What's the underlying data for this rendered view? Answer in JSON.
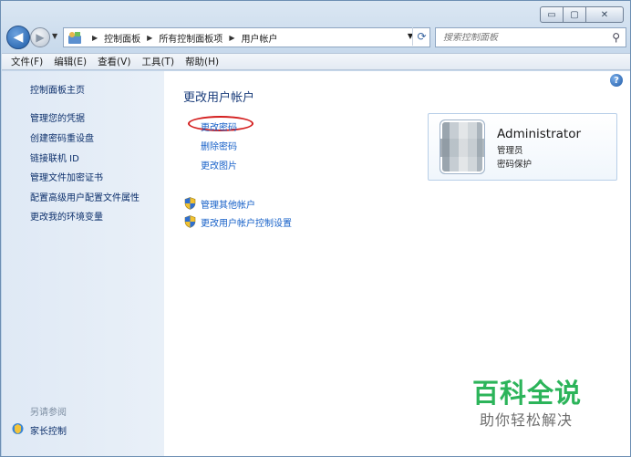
{
  "window": {
    "minimize_glyph": "▭",
    "maximize_glyph": "▢",
    "close_glyph": "✕"
  },
  "nav": {
    "back_glyph": "◀",
    "forward_glyph": "▶",
    "breadcrumbs": [
      "控制面板",
      "所有控制面板项",
      "用户帐户"
    ],
    "search_placeholder": "搜索控制面板"
  },
  "menubar": [
    "文件(F)",
    "编辑(E)",
    "查看(V)",
    "工具(T)",
    "帮助(H)"
  ],
  "sidebar": {
    "home": "控制面板主页",
    "links": [
      "管理您的凭据",
      "创建密码重设盘",
      "链接联机 ID",
      "管理文件加密证书",
      "配置高级用户配置文件属性",
      "更改我的环境变量"
    ],
    "see_also_title": "另请参阅",
    "see_also_links": [
      "家长控制"
    ]
  },
  "main": {
    "title": "更改用户帐户",
    "tasks": [
      "更改密码",
      "删除密码",
      "更改图片"
    ],
    "admin_tasks": [
      "管理其他帐户",
      "更改用户帐户控制设置"
    ]
  },
  "account": {
    "name": "Administrator",
    "role": "管理员",
    "status": "密码保护"
  },
  "watermark": {
    "brand": "百科全说",
    "slogan": "助你轻松解决"
  },
  "colors": {
    "link": "#1660c8",
    "title": "#1b3d7b",
    "highlight_oval": "#d42020",
    "watermark": "#2cb45a"
  },
  "icons": [
    "back-arrow-icon",
    "forward-arrow-icon",
    "control-panel-icon",
    "refresh-icon",
    "search-icon",
    "help-icon",
    "uac-shield-icon",
    "user-avatar"
  ]
}
